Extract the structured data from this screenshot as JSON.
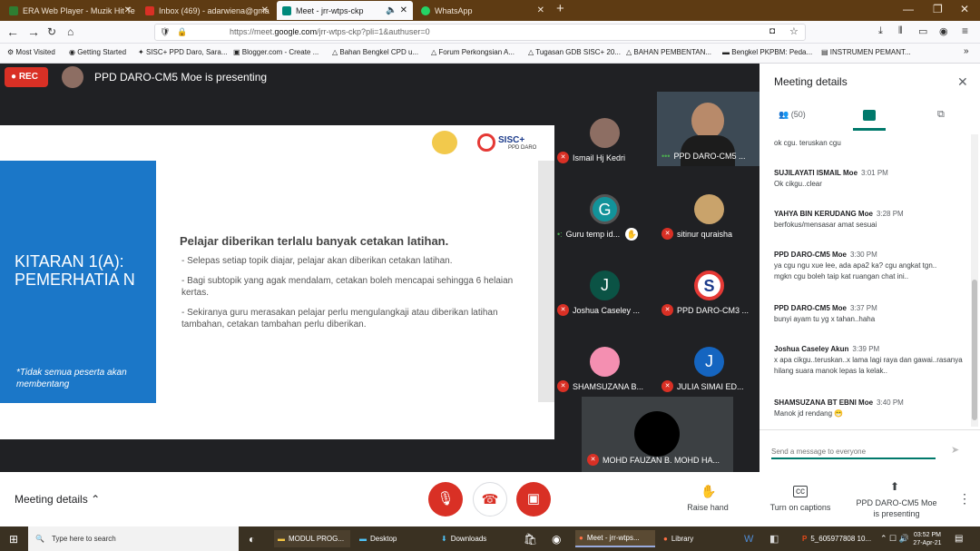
{
  "tabs": [
    {
      "label": "ERA Web Player - Muzik Hit Te",
      "color": "#2e7d32"
    },
    {
      "label": "Inbox (469) - adarwiena@gma",
      "color": "#d93025"
    },
    {
      "label": "Meet - jrr-wtps-ckp",
      "color": "#00897b"
    },
    {
      "label": "WhatsApp",
      "color": "#25d366"
    }
  ],
  "nav": {
    "url_prefix": "https://meet.",
    "url_domain": "google.com",
    "url_path": "/jrr-wtps-ckp?pli=1&authuser=0"
  },
  "bookmarks": [
    "Most Visited",
    "Getting Started",
    "SISC+ PPD Daro, Sara...",
    "Blogger.com - Create ...",
    "Bahan Bengkel CPD u...",
    "Forum Perkongsian A...",
    "Tugasan GDB SISC+ 20...",
    "BAHAN PEMBENTAN...",
    "Bengkel PKPBM: Peda...",
    "INSTRUMEN PEMANT..."
  ],
  "meet": {
    "rec": "REC",
    "presenter": "PPD DARO-CM5 Moe is presenting",
    "slide": {
      "logo_text": "SISC+",
      "logo_sub": "PPD DARO",
      "title": "KITARAN 1(A): PEMERHATIA N",
      "note": "*Tidak semua peserta akan membentang",
      "heading": "Pelajar diberikan terlalu banyak cetakan latihan.",
      "bullets": [
        "- Selepas setiap topik diajar, pelajar akan diberikan cetakan latihan.",
        "- Bagi subtopik yang agak mendalam, cetakan boleh mencapai sehingga 6 helaian kertas.",
        "- Sekiranya guru merasakan pelajar perlu mengulangkaji atau diberikan latihan tambahan, cetakan tambahan perlu diberikan."
      ]
    },
    "participants": [
      {
        "name": "Ismail Hj Kedri",
        "initial": "",
        "color": "#8d6e63"
      },
      {
        "name": "PPD DARO-CM5 ...",
        "initial": "",
        "color": "#455a64"
      },
      {
        "name": "Guru temp id...",
        "initial": "G",
        "color": "#12939a"
      },
      {
        "name": "sitinur quraisha",
        "initial": "",
        "color": "#c9a36b"
      },
      {
        "name": "Joshua Caseley ...",
        "initial": "J",
        "color": "#0b5345"
      },
      {
        "name": "PPD DARO-CM3 ...",
        "initial": "S",
        "color": "#e53935"
      },
      {
        "name": "SHAMSUZANA B...",
        "initial": "",
        "color": "#f48fb1"
      },
      {
        "name": "JULIA SIMAI ED...",
        "initial": "J",
        "color": "#1565c0"
      },
      {
        "name": "MOHD FAUZAN B. MOHD HA...",
        "initial": "",
        "color": "#000000"
      }
    ]
  },
  "panel": {
    "title": "Meeting details",
    "people_count": "(50)",
    "messages": [
      {
        "sender": "",
        "time": "",
        "text": "ok cgu. teruskan cgu"
      },
      {
        "sender": "SUJILAYATI ISMAIL Moe",
        "time": "3:01 PM",
        "text": "Ok cikgu..clear"
      },
      {
        "sender": "YAHYA BIN KERUDANG Moe",
        "time": "3:28 PM",
        "text": "berfokus/mensasar  amat sesuai"
      },
      {
        "sender": "PPD DARO-CM5 Moe",
        "time": "3:30 PM",
        "text": "ya cgu ngu xue lee, ada apa2 ka? cgu angkat tgn.. mgkn cgu boleh taip kat ruangan chat ini.."
      },
      {
        "sender": "PPD DARO-CM5 Moe",
        "time": "3:37 PM",
        "text": "bunyi ayam tu yg x tahan..haha"
      },
      {
        "sender": "Joshua Caseley Akun",
        "time": "3:39 PM",
        "text": "x apa cikgu..teruskan..x lama lagi raya dan gawai..rasanya hilang suara manok lepas la kelak.."
      },
      {
        "sender": "SHAMSUZANA BT EBNI Moe",
        "time": "3:40 PM",
        "text": "Manok jd rendang 😁"
      }
    ],
    "input_placeholder": "Send a message to everyone"
  },
  "bottom": {
    "meeting_details": "Meeting details",
    "raise_hand": "Raise hand",
    "captions": "Turn on captions",
    "presenting": "PPD DARO-CM5 Moe is presenting"
  },
  "taskbar": {
    "search": "Type here to search",
    "items": [
      "MODUL PROG...",
      "Desktop",
      "Downloads",
      "Meet - jrr-wtps...",
      "Library",
      "5_605977808 10..."
    ],
    "time": "03:52 PM",
    "date": "27-Apr-21"
  }
}
